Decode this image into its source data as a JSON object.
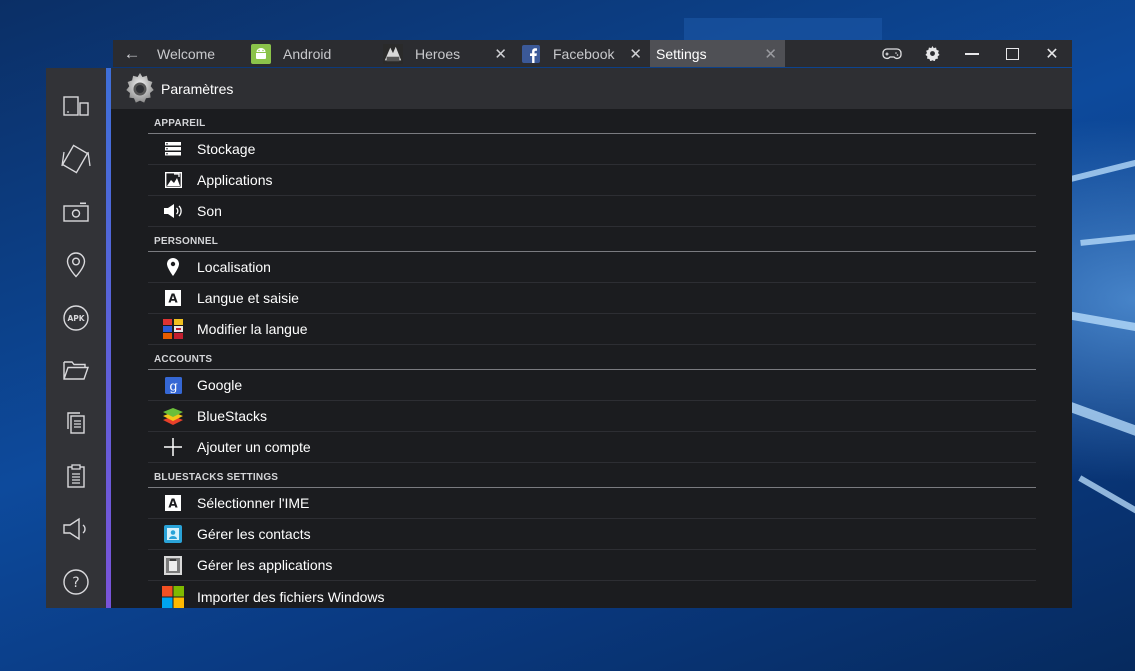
{
  "tabs": [
    {
      "label": "Welcome",
      "icon": "none"
    },
    {
      "label": "Android",
      "icon": "android-icon"
    },
    {
      "label": "Heroes",
      "icon": "heroes-game-icon"
    },
    {
      "label": "Facebook",
      "icon": "facebook-icon"
    },
    {
      "label": "Settings",
      "icon": "none",
      "active": true
    }
  ],
  "header": {
    "title": "Paramètres"
  },
  "sections": [
    {
      "title": "APPAREIL",
      "items": [
        {
          "label": "Stockage",
          "icon": "storage-icon"
        },
        {
          "label": "Applications",
          "icon": "applications-icon"
        },
        {
          "label": "Son",
          "icon": "speaker-icon"
        }
      ]
    },
    {
      "title": "PERSONNEL",
      "items": [
        {
          "label": "Localisation",
          "icon": "location-pin-icon"
        },
        {
          "label": "Langue et saisie",
          "icon": "keyboard-a-icon"
        },
        {
          "label": "Modifier la langue",
          "icon": "flags-icon"
        }
      ]
    },
    {
      "title": "ACCOUNTS",
      "items": [
        {
          "label": "Google",
          "icon": "google-icon"
        },
        {
          "label": "BlueStacks",
          "icon": "bluestacks-icon"
        },
        {
          "label": "Ajouter un compte",
          "icon": "plus-icon"
        }
      ]
    },
    {
      "title": "BLUESTACKS SETTINGS",
      "items": [
        {
          "label": "Sélectionner l'IME",
          "icon": "keyboard-a-icon"
        },
        {
          "label": "Gérer les contacts",
          "icon": "contacts-icon"
        },
        {
          "label": "Gérer les applications",
          "icon": "manage-apps-icon"
        },
        {
          "label": "Importer des fichiers Windows",
          "icon": "windows-icon"
        }
      ]
    }
  ],
  "colors": {
    "accent_top": "#3e6fd8",
    "accent_bottom": "#7a53d8",
    "android_green": "#8bc34a",
    "facebook_blue": "#3b5998"
  }
}
